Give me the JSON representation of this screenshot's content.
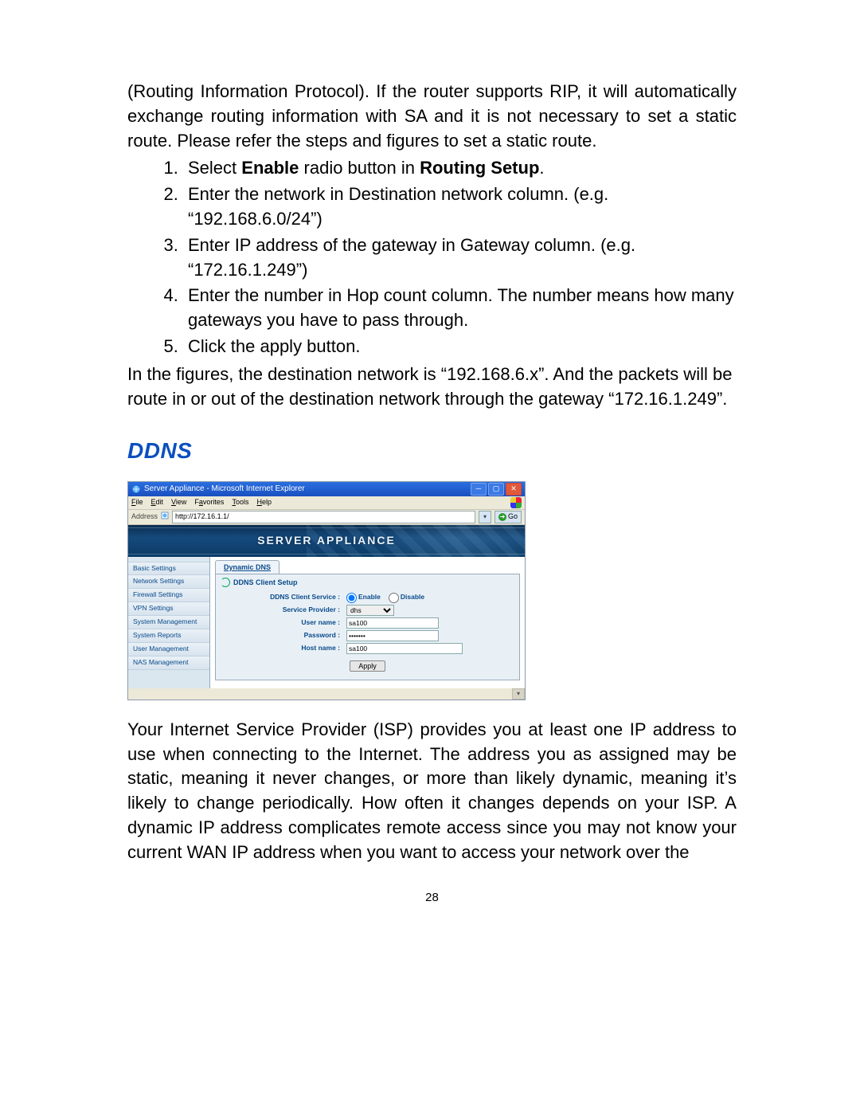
{
  "doc": {
    "intro": "(Routing Information Protocol). If the router supports RIP, it will automatically exchange routing information with SA and it is not necessary to set a static route. Please refer the steps and figures to set a static route.",
    "steps": [
      {
        "pre": "Select ",
        "b1": "Enable",
        "mid": " radio button in ",
        "b2": "Routing Setup",
        "post": "."
      },
      {
        "text": "Enter the network in Destination network column. (e.g. “192.168.6.0/24”)"
      },
      {
        "text": "Enter IP address of the gateway in Gateway column. (e.g. “172.16.1.249”)"
      },
      {
        "text": "Enter the number in Hop count column. The number means how many gateways you have to pass through."
      },
      {
        "text": "Click the apply button."
      }
    ],
    "after": "In the figures, the destination network is “192.168.6.x”. And the packets will be route in or out of the destination network through the gateway “172.16.1.249”.",
    "sectionTitle": "DDNS",
    "para2": "Your Internet Service Provider (ISP) provides you at least one IP address to use when connecting to the Internet. The address you as assigned may be static, meaning it never changes, or more than likely dynamic, meaning it’s likely to change periodically. How often it changes depends on your ISP. A dynamic IP address complicates remote access since you may not know your current WAN IP address when you want to access your network over the",
    "pageNumber": "28"
  },
  "shot": {
    "windowTitle": "Server Appliance - Microsoft Internet Explorer",
    "menu": {
      "file": "File",
      "edit": "Edit",
      "view": "View",
      "favorites": "Favorites",
      "tools": "Tools",
      "help": "Help"
    },
    "addressLabel": "Address",
    "addressValue": "http://172.16.1.1/",
    "goLabel": "Go",
    "bannerText": "SERVER APPLIANCE",
    "sidebar": [
      "Basic Settings",
      "Network Settings",
      "Firewall Settings",
      "VPN Settings",
      "System Management",
      "System Reports",
      "User Management",
      "NAS Management"
    ],
    "tab": "Dynamic DNS",
    "panelTitle": "DDNS Client Setup",
    "form": {
      "serviceLabel": "DDNS Client Service :",
      "enable": "Enable",
      "disable": "Disable",
      "providerLabel": "Service Provider :",
      "providerSelected": "dhs",
      "userLabel": "User name :",
      "userValue": "sa100",
      "passLabel": "Password :",
      "passValue": "•••••••",
      "hostLabel": "Host name :",
      "hostValue": "sa100",
      "apply": "Apply"
    }
  }
}
